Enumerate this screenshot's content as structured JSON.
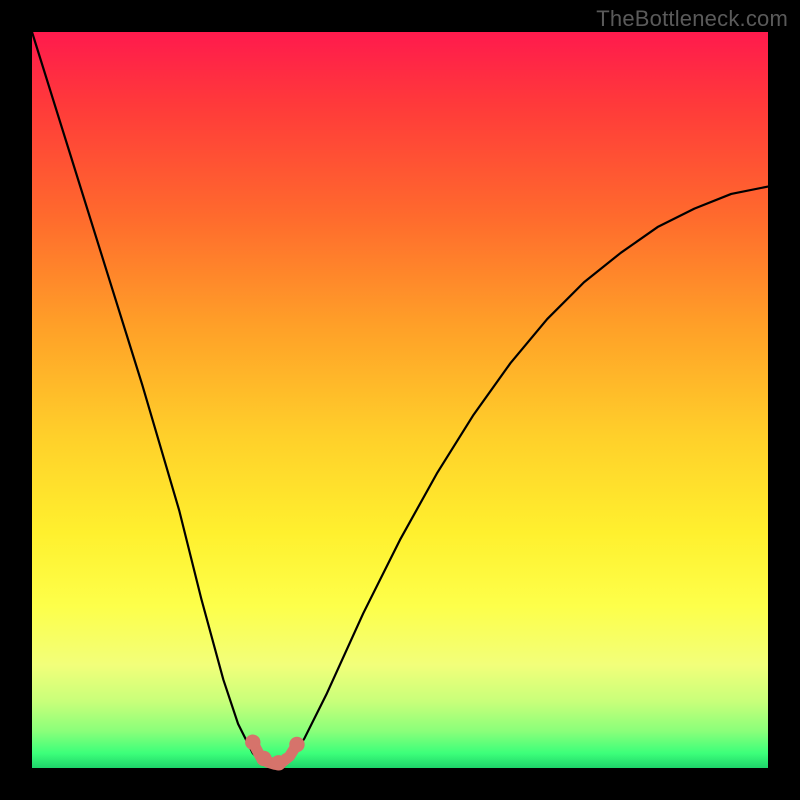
{
  "watermark": "TheBottleneck.com",
  "chart_data": {
    "type": "line",
    "title": "",
    "xlabel": "",
    "ylabel": "",
    "xlim": [
      0,
      100
    ],
    "ylim": [
      0,
      100
    ],
    "series": [
      {
        "name": "bottleneck-curve",
        "x": [
          0,
          5,
          10,
          15,
          20,
          23,
          26,
          28,
          30,
          31.5,
          33,
          34,
          35,
          37,
          40,
          45,
          50,
          55,
          60,
          65,
          70,
          75,
          80,
          85,
          90,
          95,
          100
        ],
        "y": [
          100,
          84,
          68,
          52,
          35,
          23,
          12,
          6,
          2,
          0.5,
          0,
          0,
          1,
          4,
          10,
          21,
          31,
          40,
          48,
          55,
          61,
          66,
          70,
          73.5,
          76,
          78,
          79
        ]
      }
    ],
    "markers": [
      {
        "name": "trough-point-left",
        "x": 30,
        "y": 3.5,
        "r": 1.2
      },
      {
        "name": "trough-point-mid-a",
        "x": 31.5,
        "y": 1.3,
        "r": 1.2
      },
      {
        "name": "trough-point-mid-b",
        "x": 32.2,
        "y": 0.9,
        "r": 0.8
      },
      {
        "name": "trough-point-mid-c",
        "x": 33.5,
        "y": 0.7,
        "r": 1.2
      },
      {
        "name": "trough-point-mid-d",
        "x": 34.5,
        "y": 1.3,
        "r": 0.8
      },
      {
        "name": "trough-point-right",
        "x": 36,
        "y": 3.2,
        "r": 1.2
      }
    ],
    "colors": {
      "curve": "#000000",
      "marker_fill": "#d6736b",
      "marker_stroke": "#d6736b",
      "trough_stroke": "#d6736b"
    }
  }
}
